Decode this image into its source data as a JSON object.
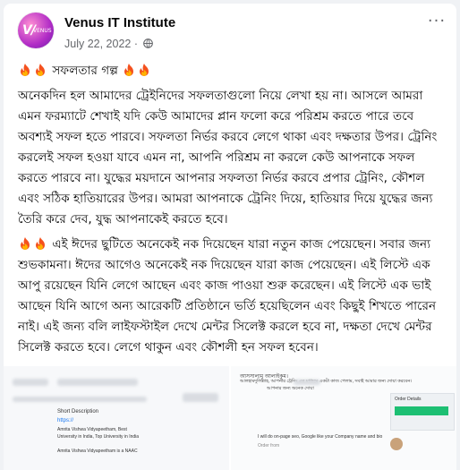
{
  "post": {
    "page_name": "Venus IT Institute",
    "avatar_text": "VENUS",
    "date": "July 22, 2022",
    "separator": "·",
    "more_label": "···",
    "title": "সফলতার গল্প",
    "paragraph1": "অনেকদিন হল আমাদের ট্রেইনিদের সফলতাগুলো নিয়ে লেখা হয় না। আসলে আমরা এমন ফরম্যাটে শেখাই যদি কেউ আমাদের প্লান ফলো করে পরিশ্রম করতে পারে তবে অবশ্যই সফল হতে পারবে। সফলতা নির্ভর করবে লেগে থাকা এবং দক্ষতার উপর। ট্রেনিং করলেই সফল হওয়া যাবে এমন না, আপনি পরিশ্রম না করলে কেউ আপনাকে সফল করতে পারবে না। যুদ্ধের ময়দানে আপনার সফলতা নির্ভর করবে প্রপার ট্রেনিং, কৌশল এবং সঠিক হাতিয়ারের উপর। আমরা আপনাকে ট্রেনিং দিয়ে, হাতিয়ার দিয়ে যুদ্ধের জন্য তৈরি করে দেব, যুদ্ধ আপনাকেই করতে হবে।",
    "paragraph2": "এই ঈদের ছুটিতে অনেকেই নক দিয়েছেন যারা নতুন কাজ পেয়েছেন। সবার জন্য শুভকামনা। ঈদের আগেও অনেকেই নক দিয়েছেন যারা কাজ পেয়েছেন। এই লিস্টে এক আপু রয়েছেন যিনি লেগে আছেন এবং কাজ পাওয়া শুরু করেছেন। এই লিস্টে এক ভাই আছেন যিনি আগে অন্য আরেকটি প্রতিষ্ঠানে ভর্তি হয়েছিলেন এবং কিছুই শিখতে পারেন নাই। এই জন্য বলি লাইফস্টাইল দেখে মেন্টর সিলেক্ট করলে হবে না, দক্ষতা দেখে মেন্টর সিলেক্ট করতে হবে। লেগে থাকুন এবং কৌশলী হন সফল হবেন।"
  },
  "image1": {
    "lines": [
      "Short Description",
      "https://",
      "Amrita Vishwa Vidyapeetham, Best",
      "University in India, Top University in India",
      "Amrita Vishwa Vidyapeetham is a NAAC"
    ]
  },
  "image2": {
    "greeting": "আসসালামু আলাইকুম।",
    "line1": "আলহামদুলিল্লাহ, আপনার ট্রেনিং এর মাধ্যমে একটা কাজ পেলাম, সবাই আমার জন্য দোয়া করবেন।",
    "line2": "আপনার জন্য অনেক দোয়া",
    "order_line": "I will do on-page seo, Google like your Company name and bio",
    "buyer": "Order from",
    "sidebar": "Order Details"
  },
  "colors": {
    "link": "#1877f2",
    "text": "#050505",
    "meta": "#65676b"
  }
}
